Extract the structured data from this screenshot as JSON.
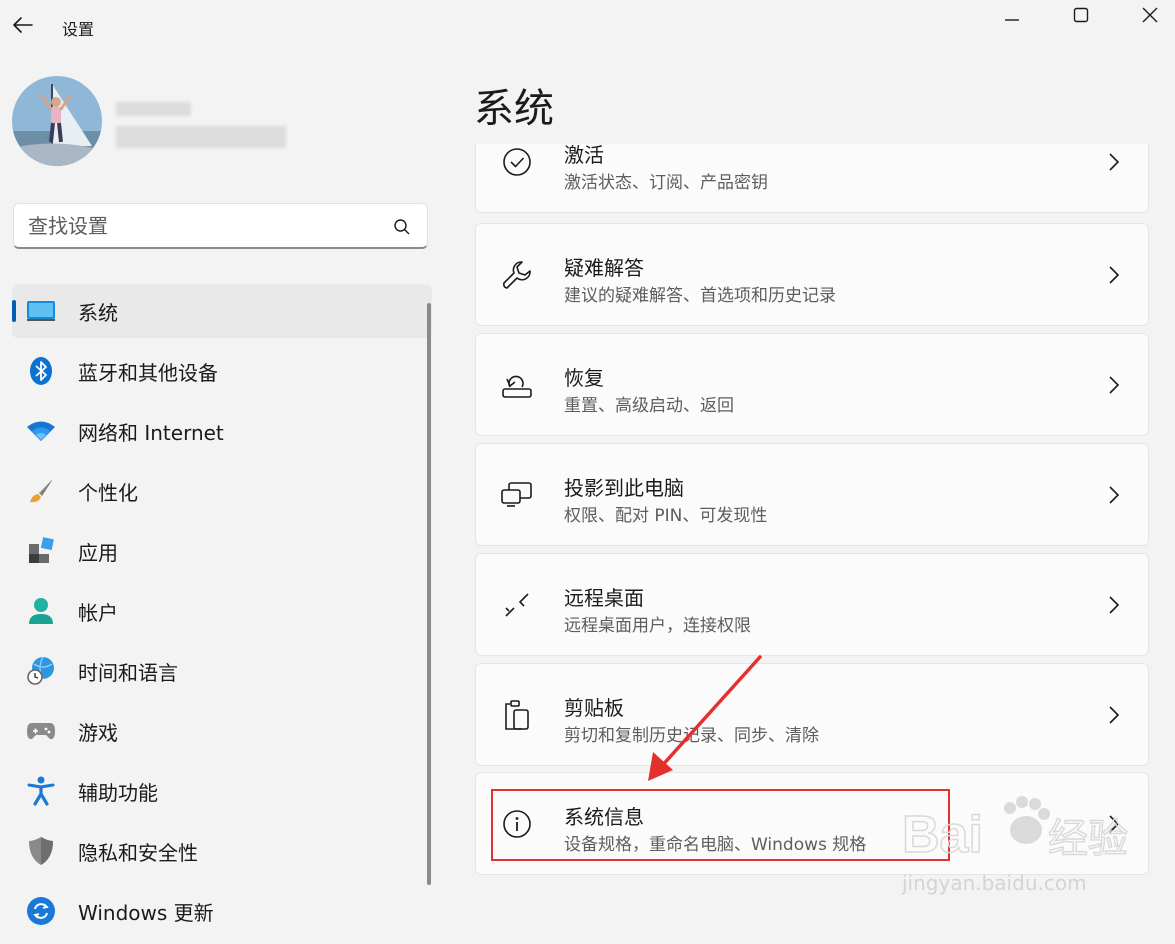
{
  "window": {
    "title": "设置"
  },
  "profile": {
    "name_hidden": "",
    "email_hidden": ""
  },
  "search": {
    "placeholder": "查找设置"
  },
  "nav": {
    "items": [
      {
        "label": "系统",
        "icon": "system-icon",
        "selected": true
      },
      {
        "label": "蓝牙和其他设备",
        "icon": "bluetooth-icon"
      },
      {
        "label": "网络和 Internet",
        "icon": "wifi-icon"
      },
      {
        "label": "个性化",
        "icon": "brush-icon"
      },
      {
        "label": "应用",
        "icon": "apps-icon"
      },
      {
        "label": "帐户",
        "icon": "account-icon"
      },
      {
        "label": "时间和语言",
        "icon": "globe-clock-icon"
      },
      {
        "label": "游戏",
        "icon": "gamepad-icon"
      },
      {
        "label": "辅助功能",
        "icon": "accessibility-icon"
      },
      {
        "label": "隐私和安全性",
        "icon": "shield-icon"
      },
      {
        "label": "Windows 更新",
        "icon": "update-icon"
      }
    ]
  },
  "main": {
    "title": "系统",
    "cards": [
      {
        "title": "激活",
        "desc": "激活状态、订阅、产品密钥",
        "icon": "check-circle-icon"
      },
      {
        "title": "疑难解答",
        "desc": "建议的疑难解答、首选项和历史记录",
        "icon": "wrench-icon"
      },
      {
        "title": "恢复",
        "desc": "重置、高级启动、返回",
        "icon": "recovery-icon"
      },
      {
        "title": "投影到此电脑",
        "desc": "权限、配对 PIN、可发现性",
        "icon": "project-icon"
      },
      {
        "title": "远程桌面",
        "desc": "远程桌面用户，连接权限",
        "icon": "remote-desktop-icon"
      },
      {
        "title": "剪贴板",
        "desc": "剪切和复制历史记录、同步、清除",
        "icon": "clipboard-icon"
      },
      {
        "title": "系统信息",
        "desc": "设备规格，重命名电脑、Windows 规格",
        "icon": "info-icon"
      }
    ]
  },
  "watermark": {
    "brand": "Bai",
    "brand2": "经验",
    "url": "jingyan.baidu.com"
  },
  "colors": {
    "accent": "#005fb8",
    "annotation": "#e53030"
  }
}
